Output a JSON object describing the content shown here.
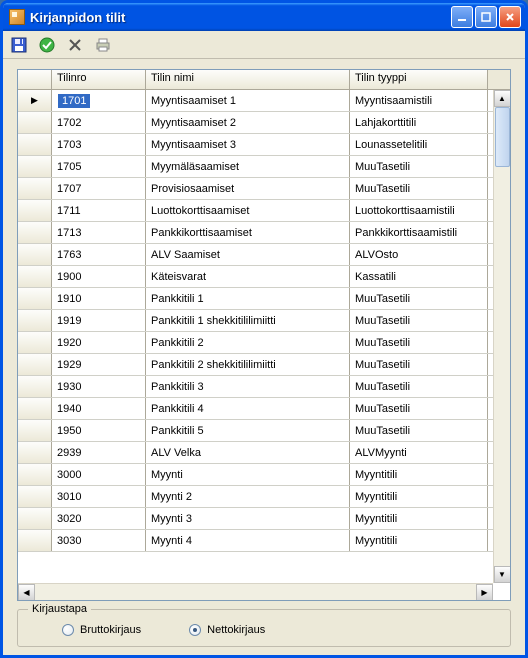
{
  "window": {
    "title": "Kirjanpidon tilit"
  },
  "grid": {
    "headers": [
      "Tilinro",
      "Tilin nimi",
      "Tilin tyyppi"
    ],
    "rows": [
      {
        "cells": [
          "1701",
          "Myyntisaamiset 1",
          "Myyntisaamistili"
        ],
        "current": true
      },
      {
        "cells": [
          "1702",
          "Myyntisaamiset 2",
          "Lahjakorttitili"
        ]
      },
      {
        "cells": [
          "1703",
          "Myyntisaamiset 3",
          "Lounassetelitili"
        ]
      },
      {
        "cells": [
          "1705",
          "Myymäläsaamiset",
          "MuuTasetili"
        ]
      },
      {
        "cells": [
          "1707",
          "Provisiosaamiset",
          "MuuTasetili"
        ]
      },
      {
        "cells": [
          "1711",
          "Luottokorttisaamiset",
          "Luottokorttisaamistili"
        ]
      },
      {
        "cells": [
          "1713",
          "Pankkikorttisaamiset",
          "Pankkikorttisaamistili"
        ]
      },
      {
        "cells": [
          "1763",
          "ALV Saamiset",
          "ALVOsto"
        ]
      },
      {
        "cells": [
          "1900",
          "Käteisvarat",
          "Kassatili"
        ]
      },
      {
        "cells": [
          "1910",
          "Pankkitili 1",
          "MuuTasetili"
        ]
      },
      {
        "cells": [
          "1919",
          "Pankkitili 1 shekkitililimiitti",
          "MuuTasetili"
        ]
      },
      {
        "cells": [
          "1920",
          "Pankkitili 2",
          "MuuTasetili"
        ]
      },
      {
        "cells": [
          "1929",
          "Pankkitili 2 shekkitililimiitti",
          "MuuTasetili"
        ]
      },
      {
        "cells": [
          "1930",
          "Pankkitili 3",
          "MuuTasetili"
        ]
      },
      {
        "cells": [
          "1940",
          "Pankkitili 4",
          "MuuTasetili"
        ]
      },
      {
        "cells": [
          "1950",
          "Pankkitili 5",
          "MuuTasetili"
        ]
      },
      {
        "cells": [
          "2939",
          "ALV Velka",
          "ALVMyynti"
        ]
      },
      {
        "cells": [
          "3000",
          "Myynti",
          "Myyntitili"
        ]
      },
      {
        "cells": [
          "3010",
          "Myynti 2",
          "Myyntitili"
        ]
      },
      {
        "cells": [
          "3020",
          "Myynti 3",
          "Myyntitili"
        ]
      },
      {
        "cells": [
          "3030",
          "Myynti 4",
          "Myyntitili"
        ]
      }
    ]
  },
  "group": {
    "legend": "Kirjaustapa",
    "options": [
      {
        "label": "Bruttokirjaus",
        "checked": false
      },
      {
        "label": "Nettokirjaus",
        "checked": true
      }
    ]
  }
}
